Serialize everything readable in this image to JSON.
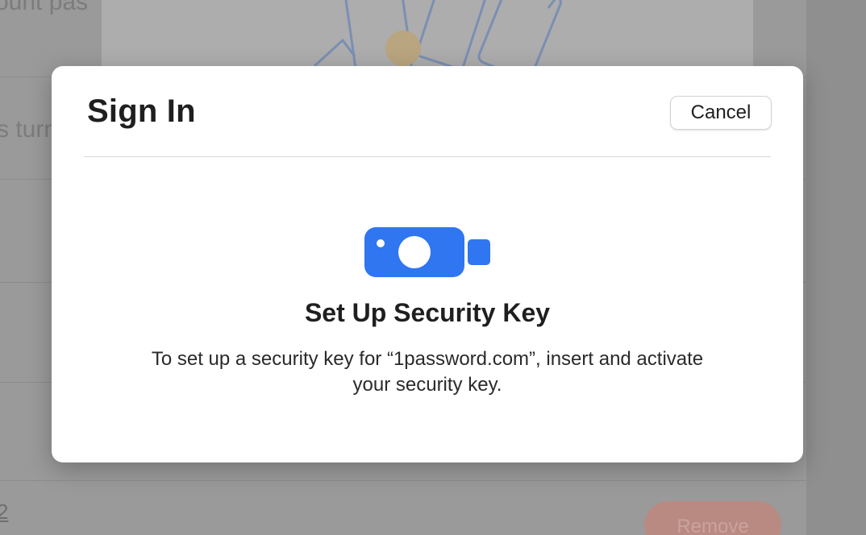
{
  "background": {
    "partial_texts": [
      "ount pas",
      "s turn"
    ],
    "row_number": "2",
    "remove_button_label": "Remove"
  },
  "modal": {
    "title": "Sign In",
    "cancel_label": "Cancel",
    "icon": "security-key-icon",
    "headline": "Set Up Security Key",
    "body": "To set up a security key for “1password.com”, insert and activate your security key."
  },
  "colors": {
    "accent": "#2f76f0",
    "modal_background": "#ffffff",
    "dim_overlay": "#8f8f8f"
  }
}
